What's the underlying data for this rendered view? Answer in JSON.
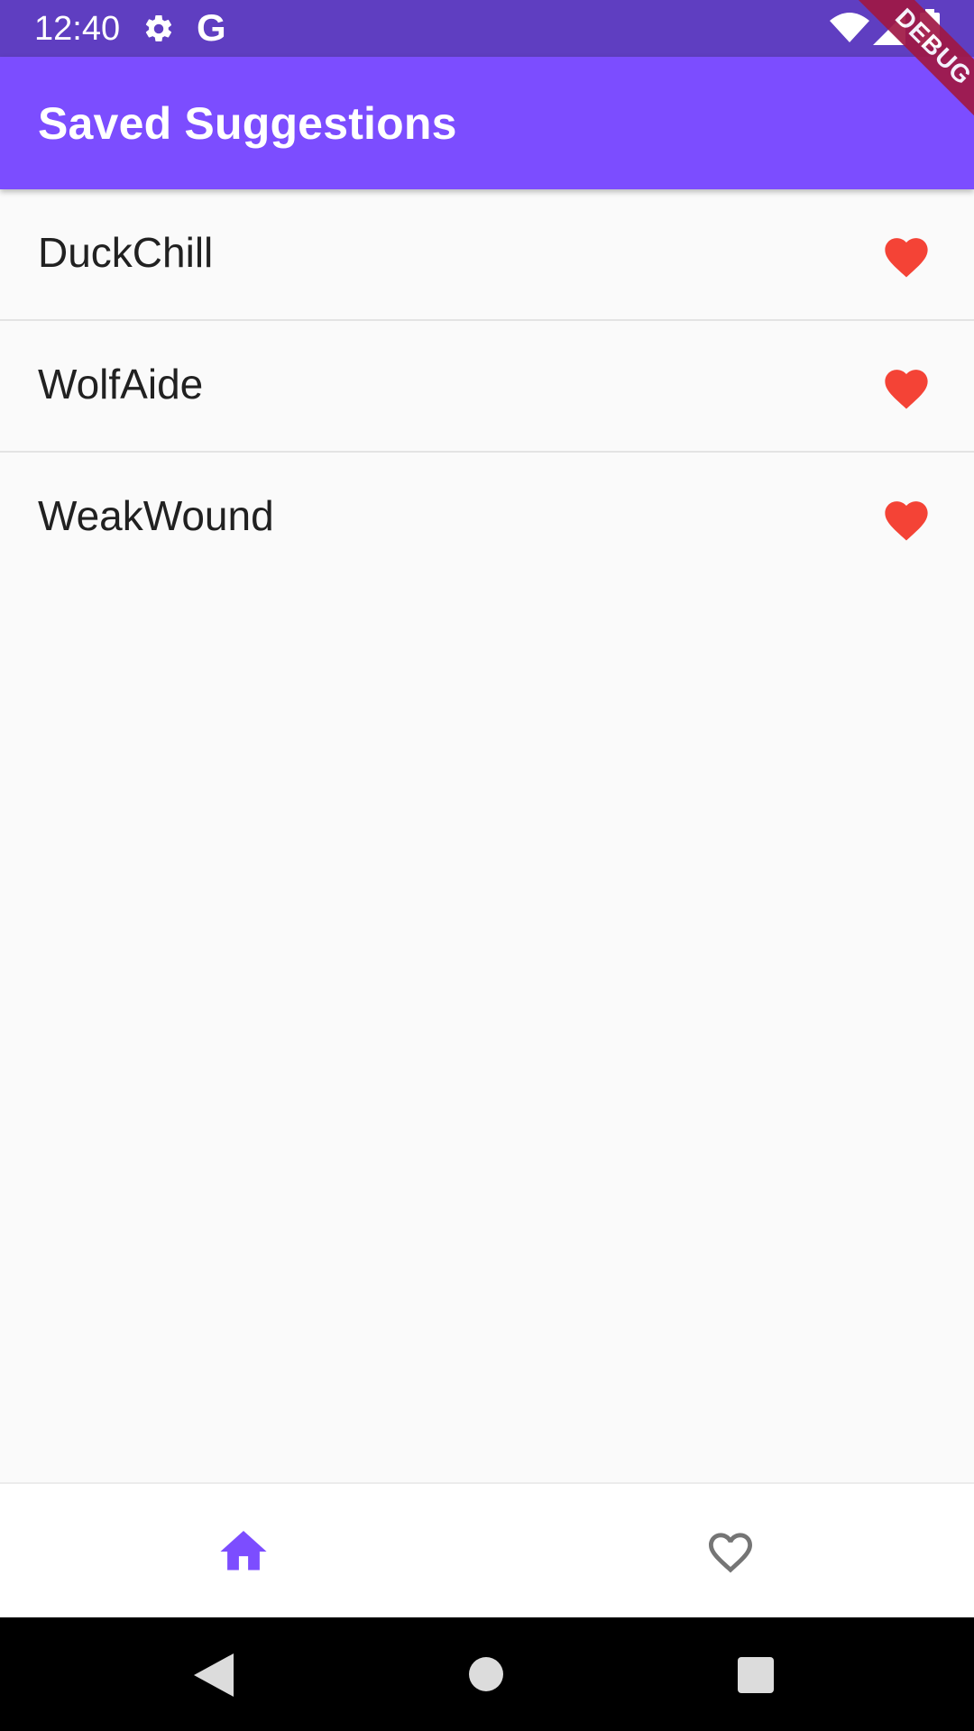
{
  "status_bar": {
    "time": "12:40",
    "settings_icon": "gear-icon",
    "google_glyph": "G",
    "wifi_icon": "wifi-icon",
    "signal_icon": "signal-icon",
    "battery_icon": "battery-icon"
  },
  "debug_banner": "DEBUG",
  "app_bar": {
    "title": "Saved Suggestions"
  },
  "saved_list": {
    "items": [
      {
        "label": "DuckChill",
        "icon": "heart-filled-icon"
      },
      {
        "label": "WolfAide",
        "icon": "heart-filled-icon"
      },
      {
        "label": "WeakWound",
        "icon": "heart-filled-icon"
      }
    ]
  },
  "bottom_nav": {
    "items": [
      {
        "icon": "home-icon",
        "selected": true
      },
      {
        "icon": "heart-outline-icon",
        "selected": false
      }
    ]
  },
  "system_nav": {
    "back_icon": "back-icon",
    "home_icon": "home-circle-icon",
    "recents_icon": "recents-icon"
  },
  "colors": {
    "status_bar": "#5f3ec1",
    "app_bar": "#7c4dff",
    "heart": "#f44336",
    "nav_selected": "#7c4dff",
    "nav_unselected": "#757575",
    "debug_banner": "#a01845"
  }
}
